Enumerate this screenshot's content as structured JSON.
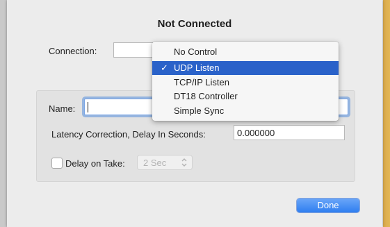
{
  "dialog": {
    "title": "Not Connected",
    "connection_label": "Connection:",
    "name_label": "Name:",
    "name_value": "",
    "latency_label": "Latency Correction, Delay In Seconds:",
    "latency_value": "0.000000",
    "delay_on_take_label": "Delay on Take:",
    "delay_on_take_checked": false,
    "delay_select_value": "2 Sec",
    "done_label": "Done"
  },
  "connection_menu": {
    "selected": "UDP Listen",
    "items": [
      {
        "label": "No Control",
        "check": ""
      },
      {
        "label": "UDP Listen",
        "check": "✓"
      },
      {
        "label": "TCP/IP Listen",
        "check": ""
      },
      {
        "label": "DT18 Controller",
        "check": ""
      },
      {
        "label": "Simple Sync",
        "check": ""
      }
    ]
  },
  "colors": {
    "accent": "#2a62c9",
    "done_button": "#3b86f3",
    "focus_ring": "#5890dc"
  }
}
